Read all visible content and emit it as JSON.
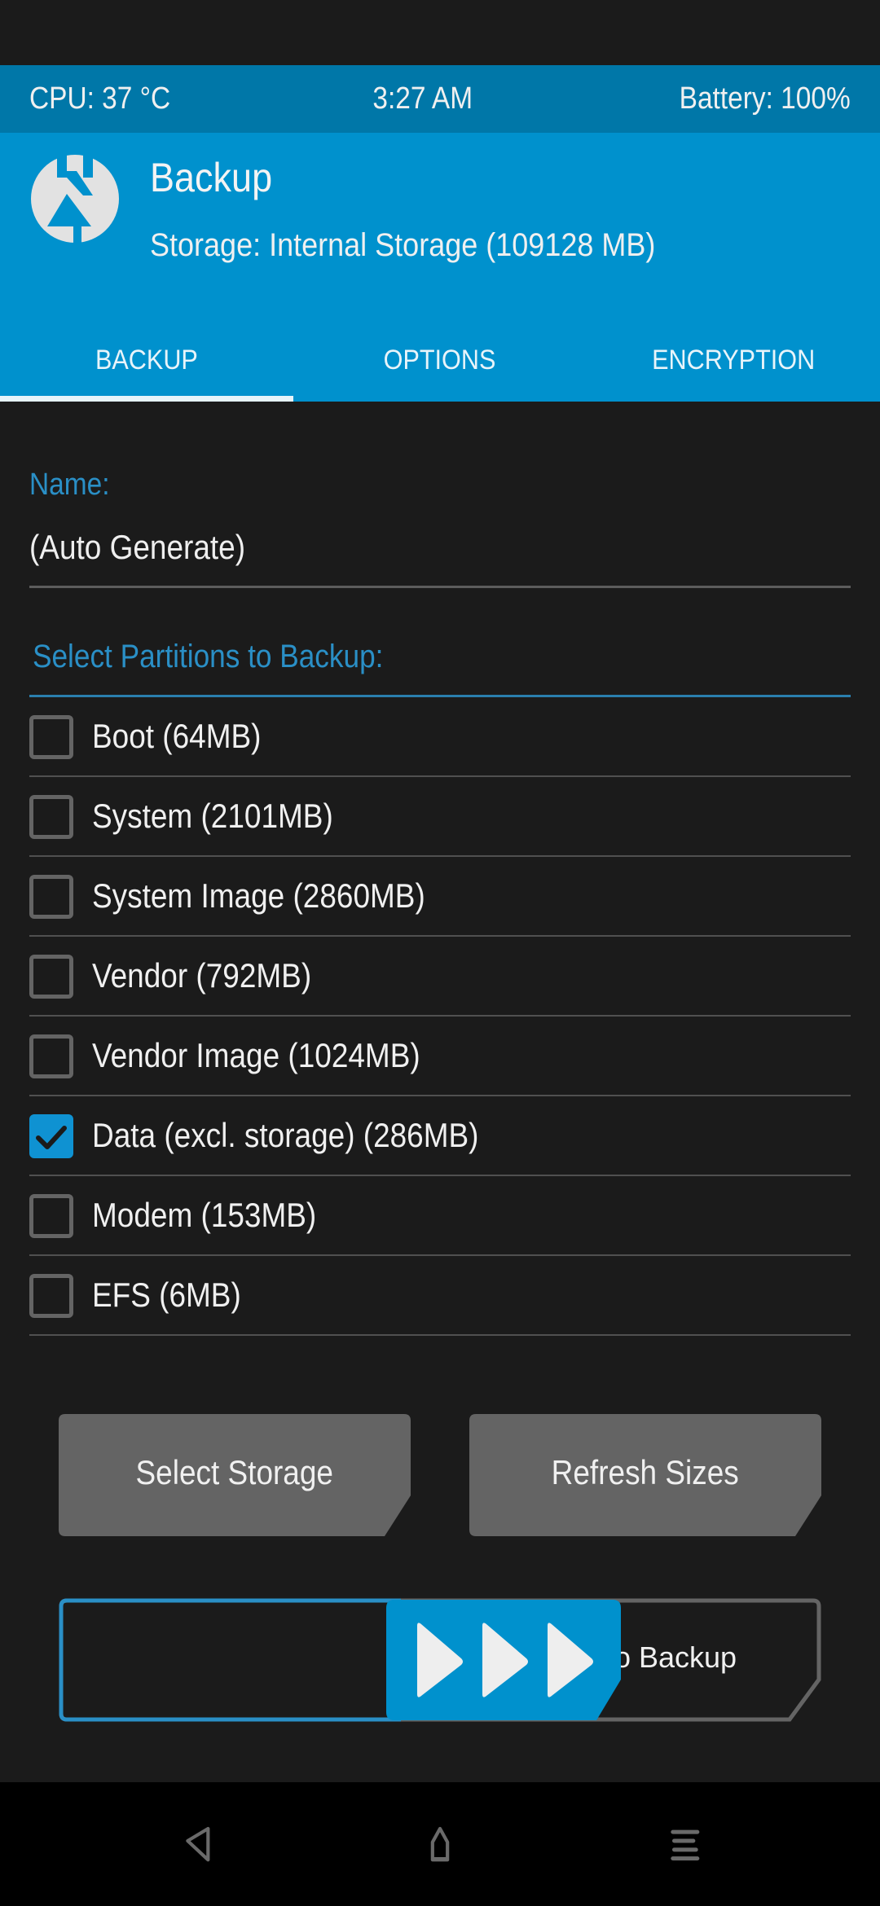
{
  "status_bar": {
    "cpu": "CPU: 37 °C",
    "time": "3:27 AM",
    "battery": "Battery: 100%"
  },
  "header": {
    "logo_icon": "twrp-logo-icon",
    "title": "Backup",
    "storage": "Storage: Internal Storage (109128 MB)"
  },
  "tabs": [
    {
      "label": "BACKUP",
      "active": true
    },
    {
      "label": "OPTIONS",
      "active": false
    },
    {
      "label": "ENCRYPTION",
      "active": false
    }
  ],
  "name_field": {
    "label": "Name:",
    "value": "(Auto Generate)"
  },
  "partitions": {
    "label": "Select Partitions to Backup:",
    "items": [
      {
        "label": "Boot (64MB)",
        "checked": false
      },
      {
        "label": "System (2101MB)",
        "checked": false
      },
      {
        "label": "System Image (2860MB)",
        "checked": false
      },
      {
        "label": "Vendor (792MB)",
        "checked": false
      },
      {
        "label": "Vendor Image (1024MB)",
        "checked": false
      },
      {
        "label": "Data (excl. storage) (286MB)",
        "checked": true
      },
      {
        "label": "Modem (153MB)",
        "checked": false
      },
      {
        "label": "EFS (6MB)",
        "checked": false
      }
    ]
  },
  "buttons": {
    "select_storage": "Select Storage",
    "refresh_sizes": "Refresh Sizes"
  },
  "swipe_slider": {
    "label": "Swipe to Backup",
    "thumb_icon": "fast-forward-arrows-icon"
  },
  "nav_bar": {
    "back_icon": "back-icon",
    "home_icon": "home-icon",
    "menu_icon": "menu-icon"
  },
  "colors": {
    "status_bar": "#0077a8",
    "header": "#0091cd",
    "accent": "#0f92d2",
    "label_blue": "#2a8fc6",
    "background": "#1b1b1b",
    "button": "#646464"
  }
}
